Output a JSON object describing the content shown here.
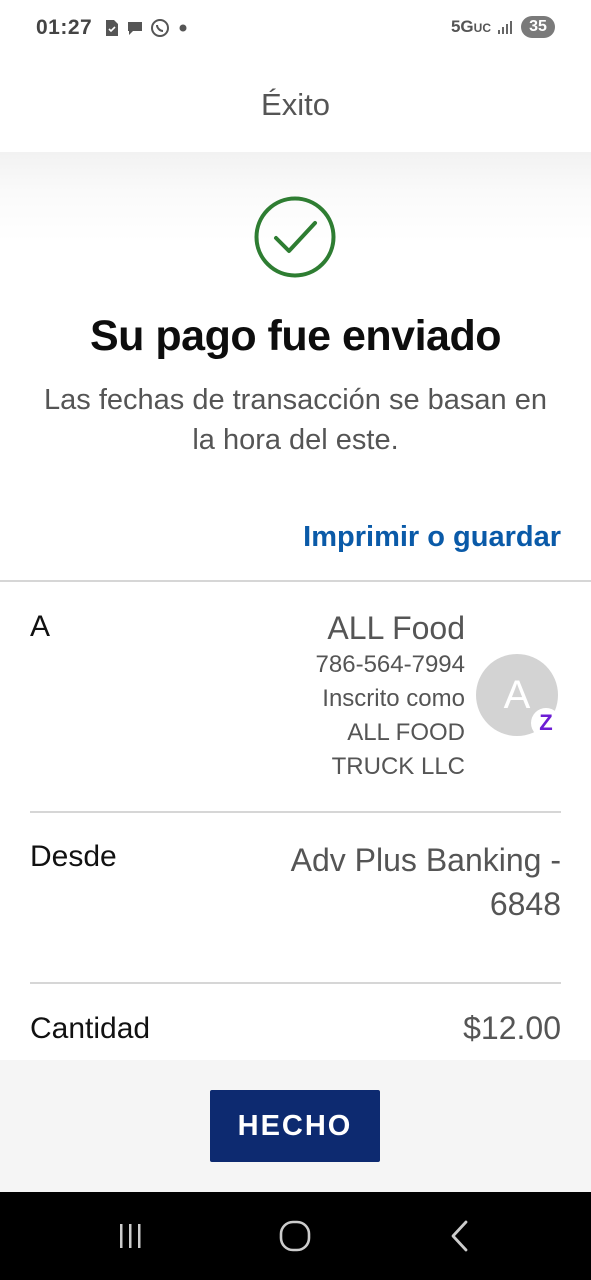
{
  "status_bar": {
    "time": "01:27",
    "network": "5G",
    "network_sub": "UC",
    "battery": "35",
    "icons": [
      "document-icon",
      "chat-icon",
      "whatsapp-icon",
      "dot-icon",
      "signal-icon"
    ]
  },
  "header": {
    "title": "Éxito"
  },
  "success": {
    "title": "Su pago fue enviado",
    "subtitle": "Las fechas de transacción se basan en la hora del este.",
    "print_link": "Imprimir o guardar",
    "check_color": "#2e7d32"
  },
  "details": {
    "to": {
      "label": "A",
      "name": "ALL Food",
      "phone": "786-564-7994",
      "enrolled_line1": "Inscrito como",
      "enrolled_line2": "ALL FOOD",
      "enrolled_line3": "TRUCK LLC",
      "avatar_letter": "A",
      "badge": "Z"
    },
    "from": {
      "label": "Desde",
      "value": "Adv Plus Banking - 6848"
    },
    "amount": {
      "label": "Cantidad",
      "value": "$12.00"
    }
  },
  "footer": {
    "done_label": "HECHO"
  },
  "colors": {
    "link": "#0a5aa8",
    "button": "#0d2a70",
    "zelle": "#6d1ed4"
  }
}
